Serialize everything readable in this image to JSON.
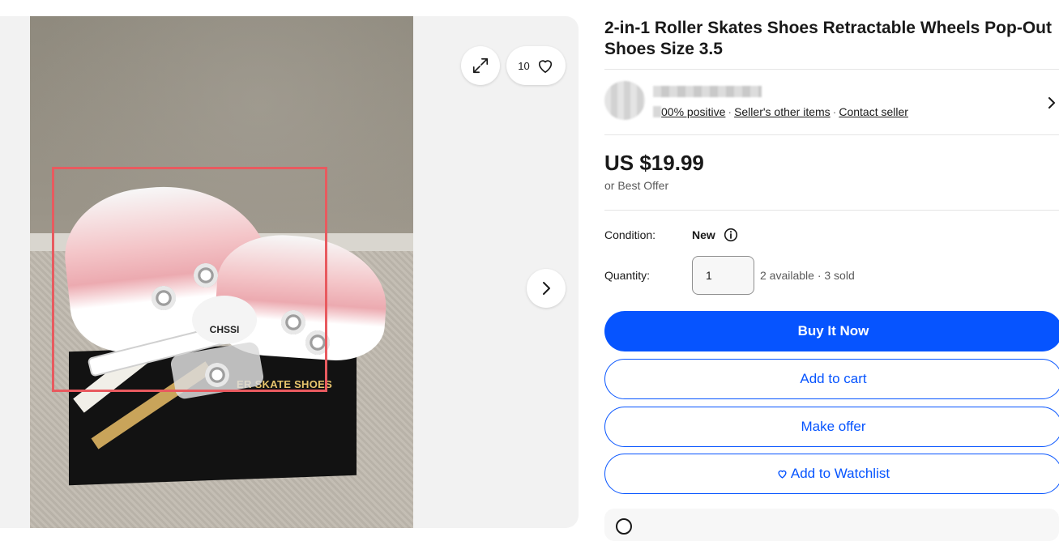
{
  "gallery": {
    "image_alt": "Pink and white retractable-wheel roller skate shoes on a black shoe box",
    "box_text": "ER SKATE SHOES",
    "badge_text": "CHSSI",
    "watch_count": "10",
    "icons": {
      "expand": "expand-icon",
      "heart": "heart-icon",
      "next": "chevron-right-icon"
    },
    "highlight_color": "#e85a5f"
  },
  "listing": {
    "title": "2-in-1 Roller Skates Shoes Retractable Wheels Pop-Out Shoes Size 3.5",
    "seller": {
      "feedback": "00% positive",
      "other_items": "Seller's other items",
      "contact": "Contact seller",
      "separator": "·"
    },
    "price": "US $19.99",
    "best_offer": "or Best Offer",
    "condition_label": "Condition:",
    "condition_value": "New",
    "quantity_label": "Quantity:",
    "quantity_value": "1",
    "availability": "2 available · 3 sold"
  },
  "actions": {
    "buy_now": "Buy It Now",
    "add_to_cart": "Add to cart",
    "make_offer": "Make offer",
    "add_to_watchlist": "Add to Watchlist"
  },
  "colors": {
    "primary": "#0654ff",
    "text": "#191919",
    "muted": "#5a5a5a",
    "divider": "#e5e5e5"
  }
}
